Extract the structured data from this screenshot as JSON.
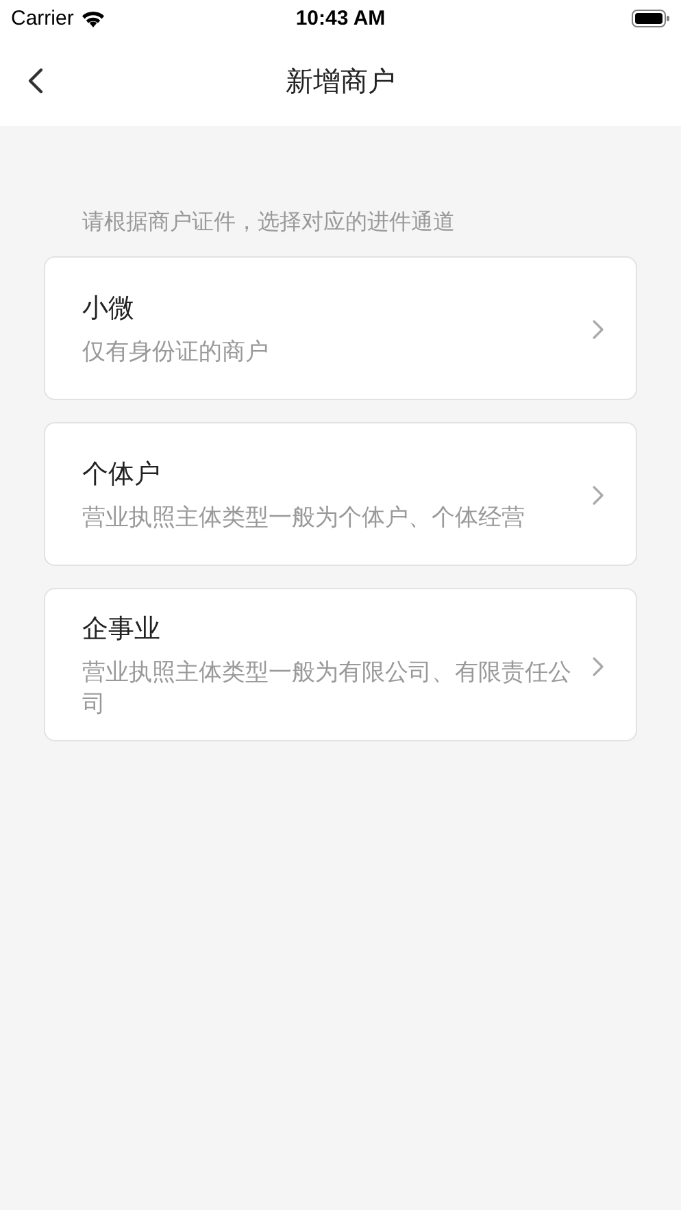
{
  "status_bar": {
    "carrier": "Carrier",
    "time": "10:43 AM"
  },
  "nav_bar": {
    "title": "新增商户"
  },
  "hint": "请根据商户证件，选择对应的进件通道",
  "options": [
    {
      "title": "小微",
      "description": "仅有身份证的商户"
    },
    {
      "title": "个体户",
      "description": "营业执照主体类型一般为个体户、个体经营"
    },
    {
      "title": "企事业",
      "description": "营业执照主体类型一般为有限公司、有限责任公司"
    }
  ]
}
